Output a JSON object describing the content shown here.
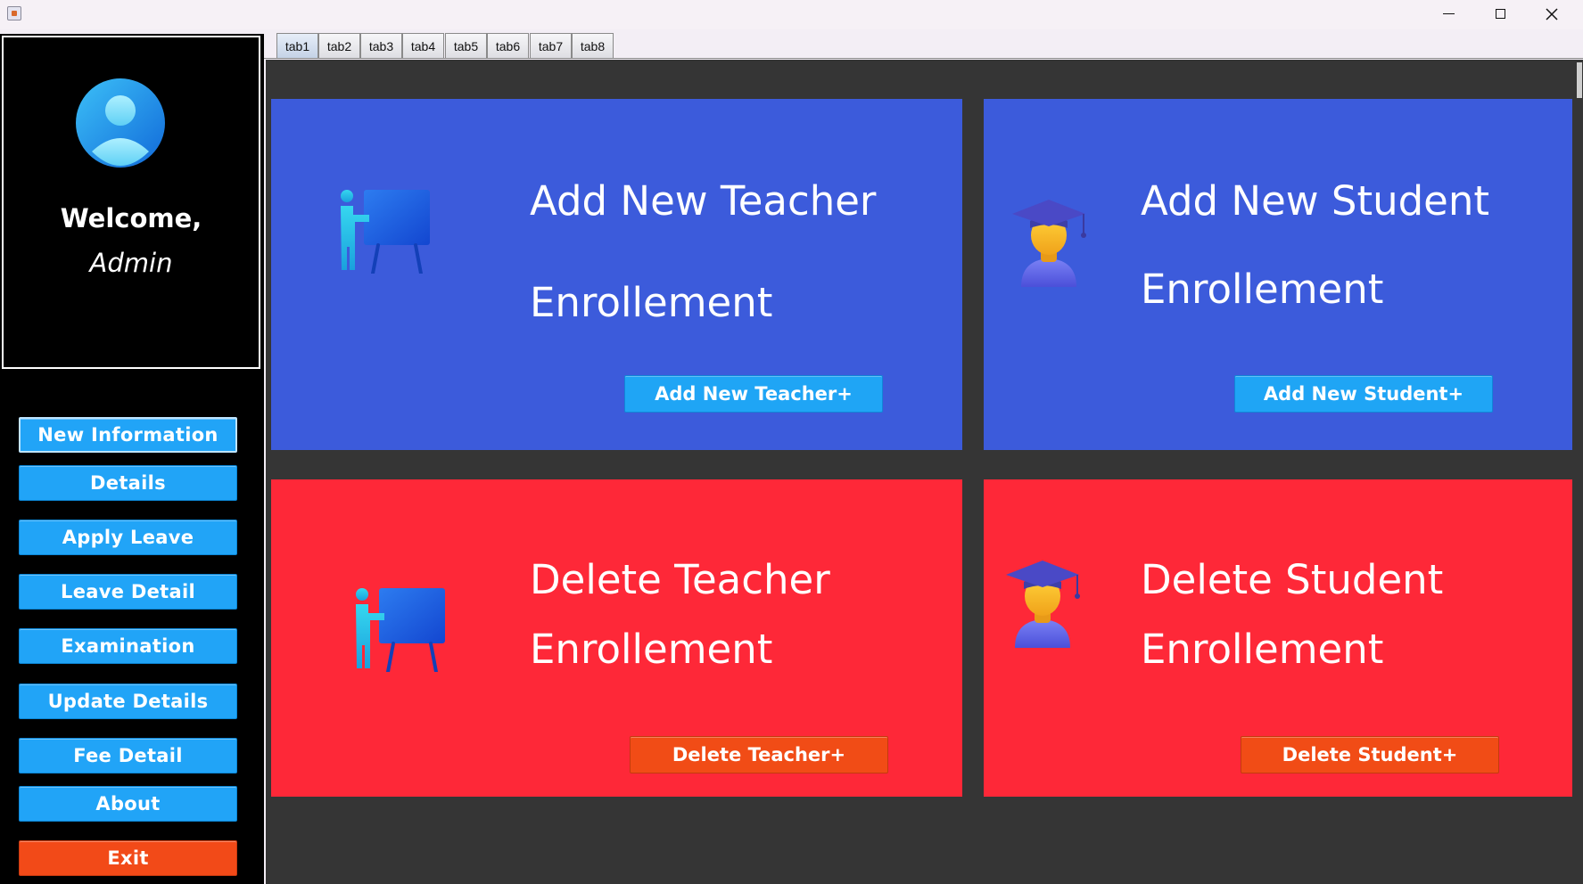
{
  "window": {
    "minimize_label": "—",
    "maximize_label": "□",
    "close_label": "✕"
  },
  "sidebar": {
    "welcome": "Welcome,",
    "user": "Admin",
    "buttons": [
      {
        "label": "New Information",
        "selected": true
      },
      {
        "label": "Details"
      },
      {
        "label": "Apply Leave"
      },
      {
        "label": "Leave Detail"
      },
      {
        "label": "Examination"
      },
      {
        "label": "Update Details"
      },
      {
        "label": "Fee Detail"
      },
      {
        "label": "About"
      },
      {
        "label": "Exit",
        "color": "#f24a18"
      }
    ]
  },
  "tabs": [
    "tab1",
    "tab2",
    "tab3",
    "tab4",
    "tab5",
    "tab6",
    "tab7",
    "tab8"
  ],
  "active_tab": "tab1",
  "panels": {
    "add_teacher": {
      "title": "Add New Teacher",
      "subtitle": "Enrollement",
      "button": "Add New Teacher+",
      "icon": "teacher-board-icon"
    },
    "add_student": {
      "title": "Add New Student",
      "subtitle": "Enrollement",
      "button": "Add New Student+",
      "icon": "graduate-student-icon"
    },
    "delete_teacher": {
      "title": "Delete Teacher",
      "subtitle": "Enrollement",
      "button": "Delete Teacher+",
      "icon": "teacher-board-icon"
    },
    "delete_student": {
      "title": "Delete Student",
      "subtitle": "Enrollement",
      "button": "Delete Student+",
      "icon": "graduate-student-icon"
    }
  },
  "colors": {
    "sidebar_bg": "#000000",
    "panel_blue": "#3c5bdb",
    "panel_red": "#fe2838",
    "button_blue": "#21a4f7",
    "button_orange": "#f24a18",
    "content_bg": "#353535"
  }
}
